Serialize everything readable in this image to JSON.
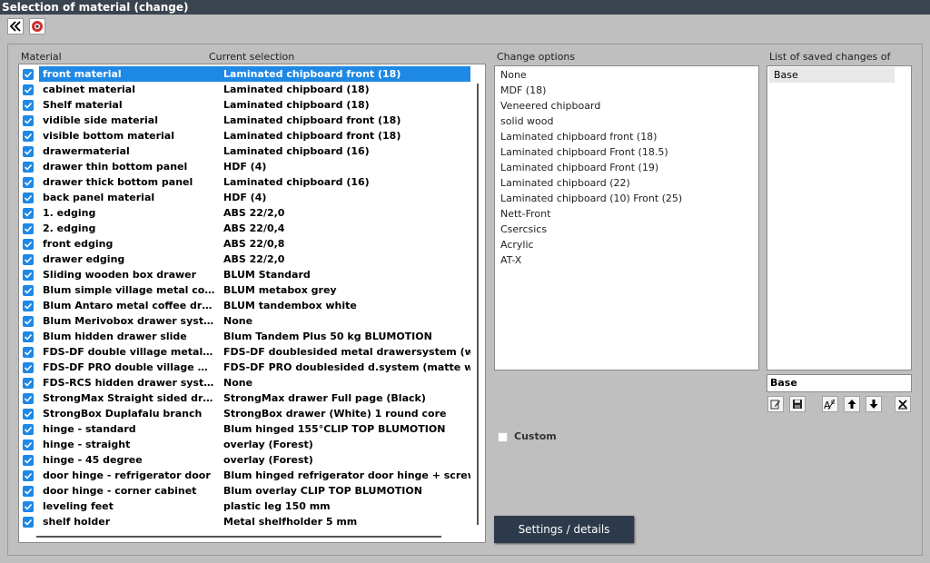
{
  "window": {
    "title": "Selection of material (change)"
  },
  "toolbar": {
    "back_icon": "double-chevron-left-icon",
    "close_icon": "red-circle-close-icon"
  },
  "headers": {
    "material": "Material",
    "current_selection": "Current selection",
    "change_options": "Change options",
    "saved_changes": "List of saved changes of"
  },
  "materials": [
    {
      "name": "front material",
      "value": "Laminated chipboard front (18)"
    },
    {
      "name": "cabinet material",
      "value": "Laminated chipboard (18)"
    },
    {
      "name": "Shelf material",
      "value": "Laminated chipboard (18)"
    },
    {
      "name": "vidible side material",
      "value": "Laminated chipboard front (18)"
    },
    {
      "name": "visible bottom material",
      "value": "Laminated chipboard front (18)"
    },
    {
      "name": "drawermaterial",
      "value": "Laminated chipboard (16)"
    },
    {
      "name": "drawer thin bottom panel",
      "value": "HDF (4)"
    },
    {
      "name": "drawer thick bottom panel",
      "value": "Laminated chipboard (16)"
    },
    {
      "name": "back panel material",
      "value": "HDF (4)"
    },
    {
      "name": "1. edging",
      "value": "ABS 22/2,0"
    },
    {
      "name": "2. edging",
      "value": "ABS 22/0,4"
    },
    {
      "name": "front edging",
      "value": "ABS 22/0,8"
    },
    {
      "name": "drawer edging",
      "value": "ABS 22/2,0"
    },
    {
      "name": "Sliding wooden box drawer",
      "value": "BLUM Standard"
    },
    {
      "name": "Blum simple village metal coffe...",
      "value": "BLUM metabox grey"
    },
    {
      "name": "Blum Antaro metal coffee drawer",
      "value": "BLUM tandembox white"
    },
    {
      "name": "Blum Merivobox drawer system",
      "value": "None"
    },
    {
      "name": "Blum hidden drawer slide",
      "value": "Blum Tandem Plus 50 kg BLUMOTION"
    },
    {
      "name": "FDS-DF double village metal c...",
      "value": "FDS-DF doublesided metal drawersystem (white)"
    },
    {
      "name": "FDS-DF PRO double village m...",
      "value": "FDS-DF PRO doublesided d.system (matte white"
    },
    {
      "name": "FDS-RCS hidden drawer system",
      "value": "None"
    },
    {
      "name": "StrongMax Straight sided drawer",
      "value": "StrongMax drawer Full page (Black)"
    },
    {
      "name": "StrongBox Duplafalu branch",
      "value": "StrongBox drawer (White) 1 round core"
    },
    {
      "name": "hinge - standard",
      "value": "Blum hinged 155°CLIP TOP BLUMOTION"
    },
    {
      "name": "hinge - straight",
      "value": "overlay (Forest)"
    },
    {
      "name": "hinge - 45 degree",
      "value": "overlay (Forest)"
    },
    {
      "name": "door hinge - refrigerator door",
      "value": "Blum hinged refrigerator door hinge + screw base"
    },
    {
      "name": "door hinge - corner cabinet",
      "value": "Blum overlay CLIP TOP BLUMOTION"
    },
    {
      "name": "leveling feet",
      "value": "plastic leg 150 mm"
    },
    {
      "name": "shelf holder",
      "value": "Metal shelfholder 5 mm"
    }
  ],
  "change_options": [
    "None",
    "MDF (18)",
    "Veneered chipboard",
    "solid wood",
    "Laminated chipboard front (18)",
    "Laminated chipboard Front (18.5)",
    "Laminated chipboard Front (19)",
    "Laminated chipboard (22)",
    "Laminated chipboard (10) Front (25)",
    "Nett-Front",
    "Csercsics",
    "Acrylic",
    "AT-X"
  ],
  "saved_changes": {
    "items": [
      "Base"
    ],
    "name_value": "Base"
  },
  "custom_label": "Custom",
  "settings_button": "Settings / details",
  "accent_color": "#1e88e5",
  "titlebar_color": "#3a4450"
}
